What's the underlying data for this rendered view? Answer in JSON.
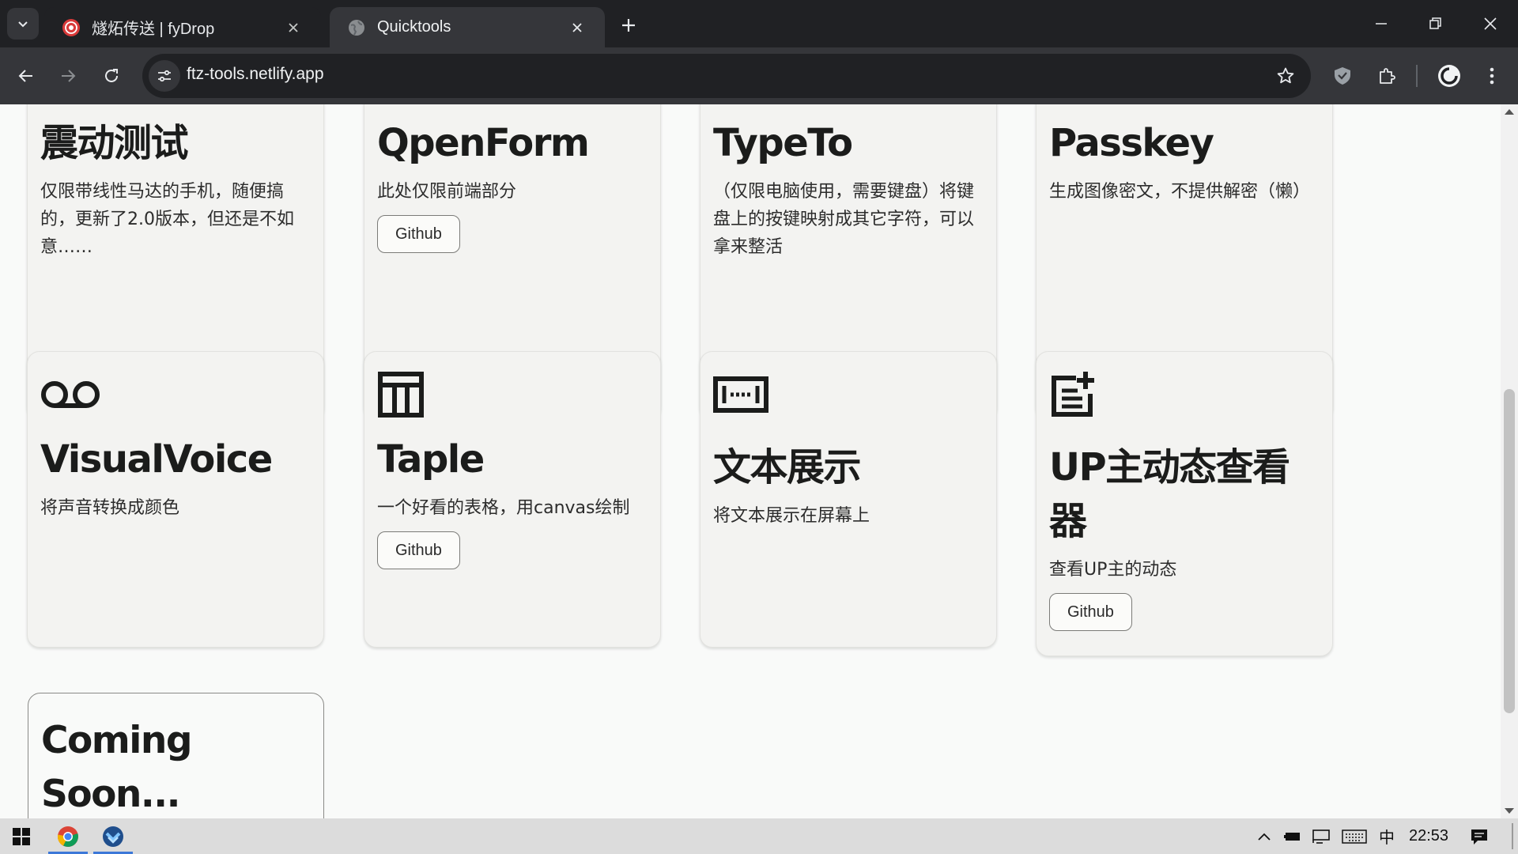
{
  "browser": {
    "tabs": [
      {
        "title": "燧炻传送 | fyDrop",
        "active": false,
        "favicon": "fydrop-icon"
      },
      {
        "title": "Quicktools",
        "active": true,
        "favicon": "globe-icon"
      }
    ],
    "url": "ftz-tools.netlify.app"
  },
  "cards": [
    {
      "title": "震动测试",
      "desc": "仅限带线性马达的手机，随便搞的，更新了2.0版本，但还是不如意……"
    },
    {
      "title": "QpenForm",
      "desc": "此处仅限前端部分",
      "button": "Github"
    },
    {
      "title": "TypeTo",
      "desc": "（仅限电脑使用，需要键盘）将键盘上的按键映射成其它字符，可以拿来整活"
    },
    {
      "title": "Passkey",
      "desc": "生成图像密文，不提供解密（懒）"
    },
    {
      "title": "VisualVoice",
      "desc": "将声音转换成颜色",
      "icon": "voicemail-icon"
    },
    {
      "title": "Taple",
      "desc": "一个好看的表格，用canvas绘制",
      "button": "Github",
      "icon": "table-icon"
    },
    {
      "title": "文本展示",
      "desc": "将文本展示在屏幕上",
      "icon": "text-display-icon"
    },
    {
      "title": "UP主动态查看器",
      "desc": "查看UP主的动态",
      "button": "Github",
      "icon": "post-add-icon"
    },
    {
      "title": "Coming Soon..."
    }
  ],
  "taskbar": {
    "ime": "中",
    "time": "22:53"
  },
  "colors": {
    "chrome_dark": "#202124",
    "chrome_toolbar": "#35363a",
    "card_bg": "#f3f3f1",
    "page_bg": "#f9faf9"
  }
}
